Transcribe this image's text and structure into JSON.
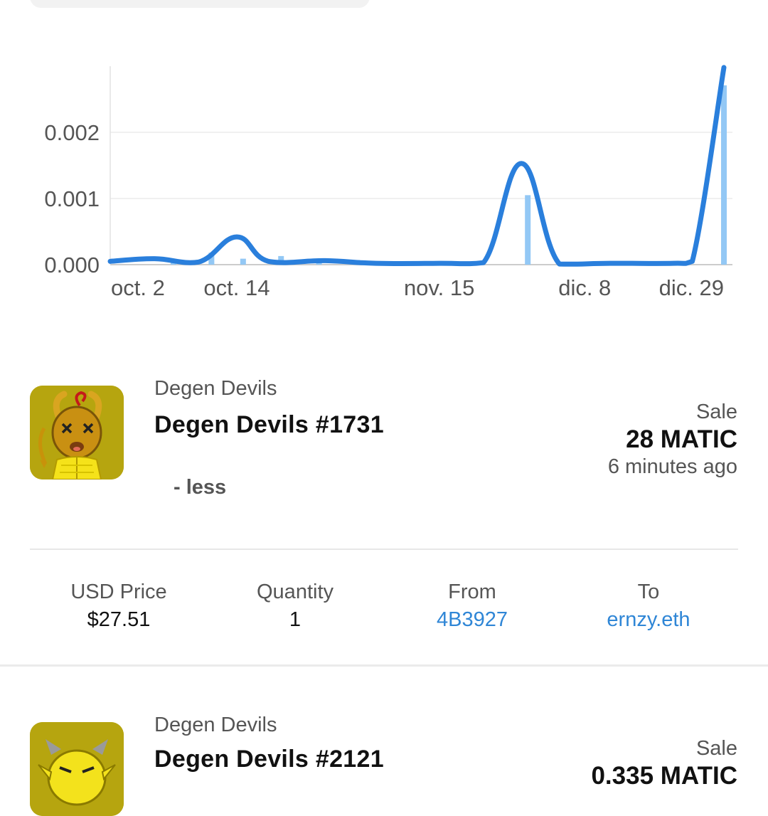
{
  "chart_data": {
    "type": "line",
    "y_ticks": [
      "0.000",
      "0.001",
      "0.002"
    ],
    "x_ticks": [
      "oct. 2",
      "oct. 14",
      "nov. 15",
      "dic. 8",
      "dic. 29"
    ],
    "ylim": [
      0,
      0.003
    ],
    "grid": true,
    "line_color": "#2a7fdc",
    "bar_color": "#93c8f5",
    "series": [
      {
        "type": "line",
        "points": [
          {
            "x": "sep. 24",
            "y": 5e-05
          },
          {
            "x": "oct. 1",
            "y": 9e-05
          },
          {
            "x": "oct. 8",
            "y": 4e-05
          },
          {
            "x": "oct. 14",
            "y": 0.00042
          },
          {
            "x": "oct. 19",
            "y": 5e-05
          },
          {
            "x": "oct. 28",
            "y": 6e-05
          },
          {
            "x": "nov. 5",
            "y": 2e-05
          },
          {
            "x": "nov. 15",
            "y": 2e-05
          },
          {
            "x": "nov. 22",
            "y": 3e-05
          },
          {
            "x": "nov. 28",
            "y": 0.00153
          },
          {
            "x": "dic. 4",
            "y": 1e-05
          },
          {
            "x": "dic. 12",
            "y": 2e-05
          },
          {
            "x": "dic. 22",
            "y": 2e-05
          },
          {
            "x": "dic. 25",
            "y": 5e-05
          },
          {
            "x": "dic. 30",
            "y": 0.00298
          }
        ]
      },
      {
        "type": "bar",
        "points": [
          {
            "x": "oct. 4",
            "y": 8e-05
          },
          {
            "x": "oct. 10",
            "y": 0.00018
          },
          {
            "x": "oct. 15",
            "y": 9e-05
          },
          {
            "x": "oct. 21",
            "y": 0.00013
          },
          {
            "x": "oct. 27",
            "y": 9e-05
          },
          {
            "x": "nov. 2",
            "y": 7e-05
          },
          {
            "x": "nov. 29",
            "y": 0.00105
          },
          {
            "x": "dic. 30",
            "y": 0.00271
          }
        ]
      }
    ]
  },
  "sales": [
    {
      "collection": "Degen Devils",
      "name": "Degen Devils #1731",
      "event": "Sale",
      "price": "28 MATIC",
      "time": "6 minutes ago",
      "toggle_label": "- less",
      "details": {
        "usd_label": "USD Price",
        "usd_value": "$27.51",
        "qty_label": "Quantity",
        "qty_value": "1",
        "from_label": "From",
        "from_value": "4B3927",
        "to_label": "To",
        "to_value": "ernzy.eth"
      }
    },
    {
      "collection": "Degen Devils",
      "name": "Degen Devils #2121",
      "event": "Sale",
      "price": "0.335 MATIC"
    }
  ]
}
